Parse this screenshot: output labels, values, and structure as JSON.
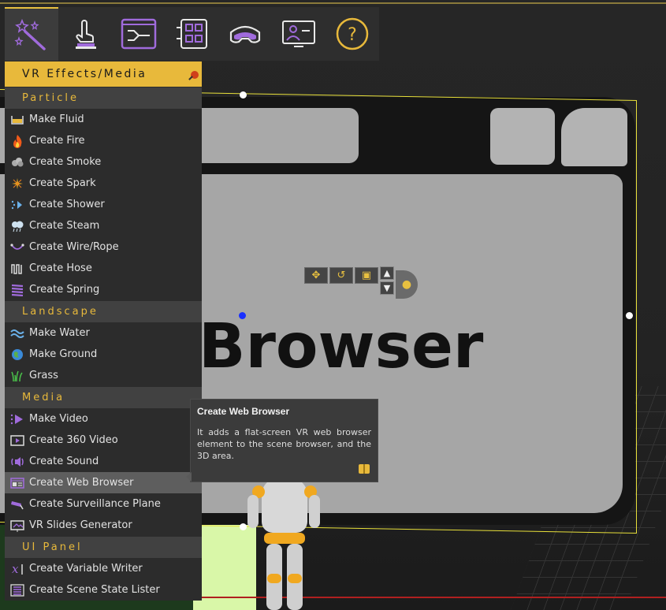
{
  "colors": {
    "accent": "#e8b93b",
    "menu_bg": "#2c2c2c",
    "section_bg": "#414141",
    "selected_bg": "#5e5e5e",
    "selection_frame": "#e8e03a",
    "icon_purple": "#a06bdc"
  },
  "toolbar": {
    "buttons": [
      {
        "icon": "magic-wand-icon",
        "active": true
      },
      {
        "icon": "touch-hand-icon"
      },
      {
        "icon": "flowchart-icon"
      },
      {
        "icon": "grid-blocks-icon"
      },
      {
        "icon": "vr-headset-icon"
      },
      {
        "icon": "presentation-screen-icon"
      },
      {
        "icon": "help-circle-icon"
      }
    ],
    "help_label": "?"
  },
  "menu": {
    "title": "VR Effects/Media",
    "sections": {
      "particle": "Particle",
      "landscape": "Landscape",
      "media": "Media",
      "ui_panel": "UI Panel"
    },
    "items": {
      "make_fluid": "Make Fluid",
      "create_fire": "Create Fire",
      "create_smoke": "Create Smoke",
      "create_spark": "Create Spark",
      "create_shower": "Create Shower",
      "create_steam": "Create Steam",
      "create_wire_rope": "Create Wire/Rope",
      "create_hose": "Create Hose",
      "create_spring": "Create Spring",
      "make_water": "Make Water",
      "make_ground": "Make Ground",
      "grass": "Grass",
      "make_video": "Make Video",
      "create_360_video": "Create 360 Video",
      "create_sound": "Create Sound",
      "create_web_browser": "Create Web Browser",
      "create_surveillance_plane": "Create Surveillance Plane",
      "vr_slides_generator": "VR Slides Generator",
      "create_variable_writer": "Create Variable Writer",
      "create_scene_state_lister": "Create Scene State Lister"
    },
    "selected_item": "Create Web Browser"
  },
  "tooltip": {
    "title": "Create Web Browser",
    "body": "It adds a flat-screen VR web browser element to the scene browser, and the 3D area."
  },
  "scene": {
    "browser_text": "Browser"
  }
}
